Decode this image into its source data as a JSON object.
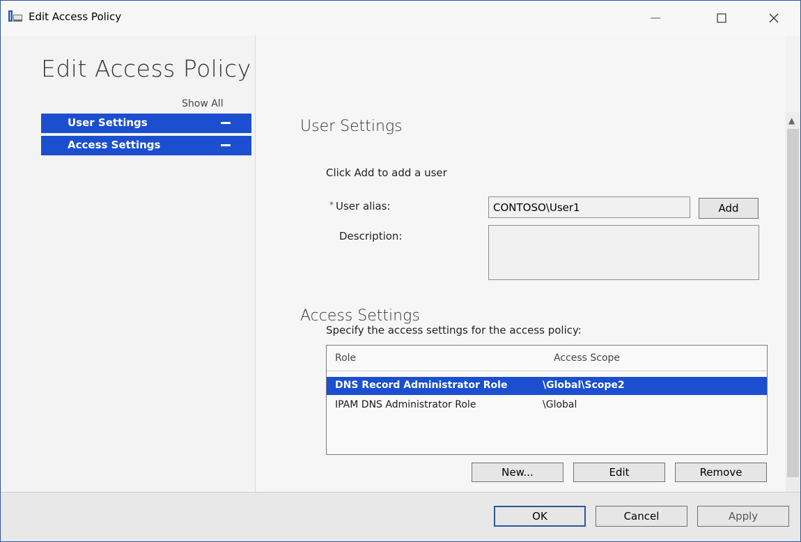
{
  "window": {
    "title": "Edit Access Policy"
  },
  "nav": {
    "page_title": "Edit Access Policy",
    "show_all": "Show All",
    "items": [
      {
        "label": "User Settings"
      },
      {
        "label": "Access Settings"
      }
    ]
  },
  "user_settings": {
    "heading": "User Settings",
    "instruction": "Click Add to add a user",
    "alias_required_mark": "*",
    "alias_label": "User alias:",
    "alias_value": "CONTOSO\\User1",
    "add_label": "Add",
    "description_label": "Description:",
    "description_value": ""
  },
  "access_settings": {
    "heading": "Access Settings",
    "instruction": "Specify the access settings for the access policy:",
    "columns": [
      "Role",
      "Access Scope"
    ],
    "rows": [
      {
        "role": "DNS Record Administrator Role",
        "scope": "\\Global\\Scope2",
        "selected": true
      },
      {
        "role": "IPAM DNS Administrator Role",
        "scope": "\\Global",
        "selected": false
      }
    ],
    "new_label": "New...",
    "edit_label": "Edit",
    "remove_label": "Remove"
  },
  "footer": {
    "ok_label": "OK",
    "cancel_label": "Cancel",
    "apply_label": "Apply"
  },
  "icons": {
    "app": "policy-app-icon",
    "minimize": "minimize-icon",
    "maximize": "maximize-icon",
    "close": "close-icon",
    "scroll_up": "chevron-up-icon"
  },
  "colors": {
    "accent": "#1b4fd0",
    "window_border": "#2b5797",
    "background": "#f3f3f3"
  }
}
